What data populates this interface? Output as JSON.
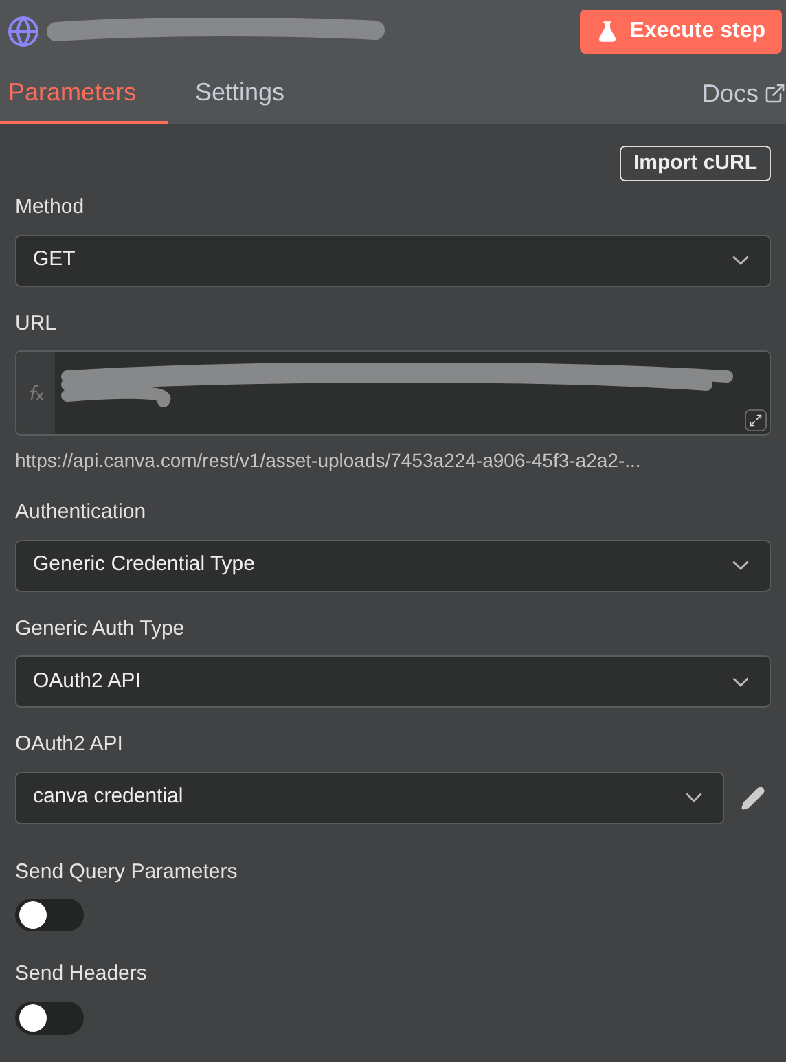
{
  "header": {
    "execute_button": "Execute step"
  },
  "tabs": [
    {
      "label": "Parameters",
      "selected": true
    },
    {
      "label": "Settings",
      "selected": false
    }
  ],
  "docs_link": "Docs",
  "import_button": "Import cURL",
  "fields": [
    {
      "kind": "select",
      "label": "Method",
      "value": "GET"
    },
    {
      "kind": "expression",
      "label": "URL",
      "hint": "https://api.canva.com/rest/v1/asset-uploads/7453a224-a906-45f3-a2a2-..."
    },
    {
      "kind": "select",
      "label": "Authentication",
      "value": "Generic Credential Type"
    },
    {
      "kind": "select",
      "label": "Generic Auth Type",
      "value": "OAuth2 API"
    },
    {
      "kind": "credential",
      "label": "OAuth2 API",
      "value": "canva credential"
    },
    {
      "kind": "toggle",
      "label": "Send Query Parameters",
      "on": false
    },
    {
      "kind": "toggle",
      "label": "Send Headers",
      "on": false
    }
  ]
}
